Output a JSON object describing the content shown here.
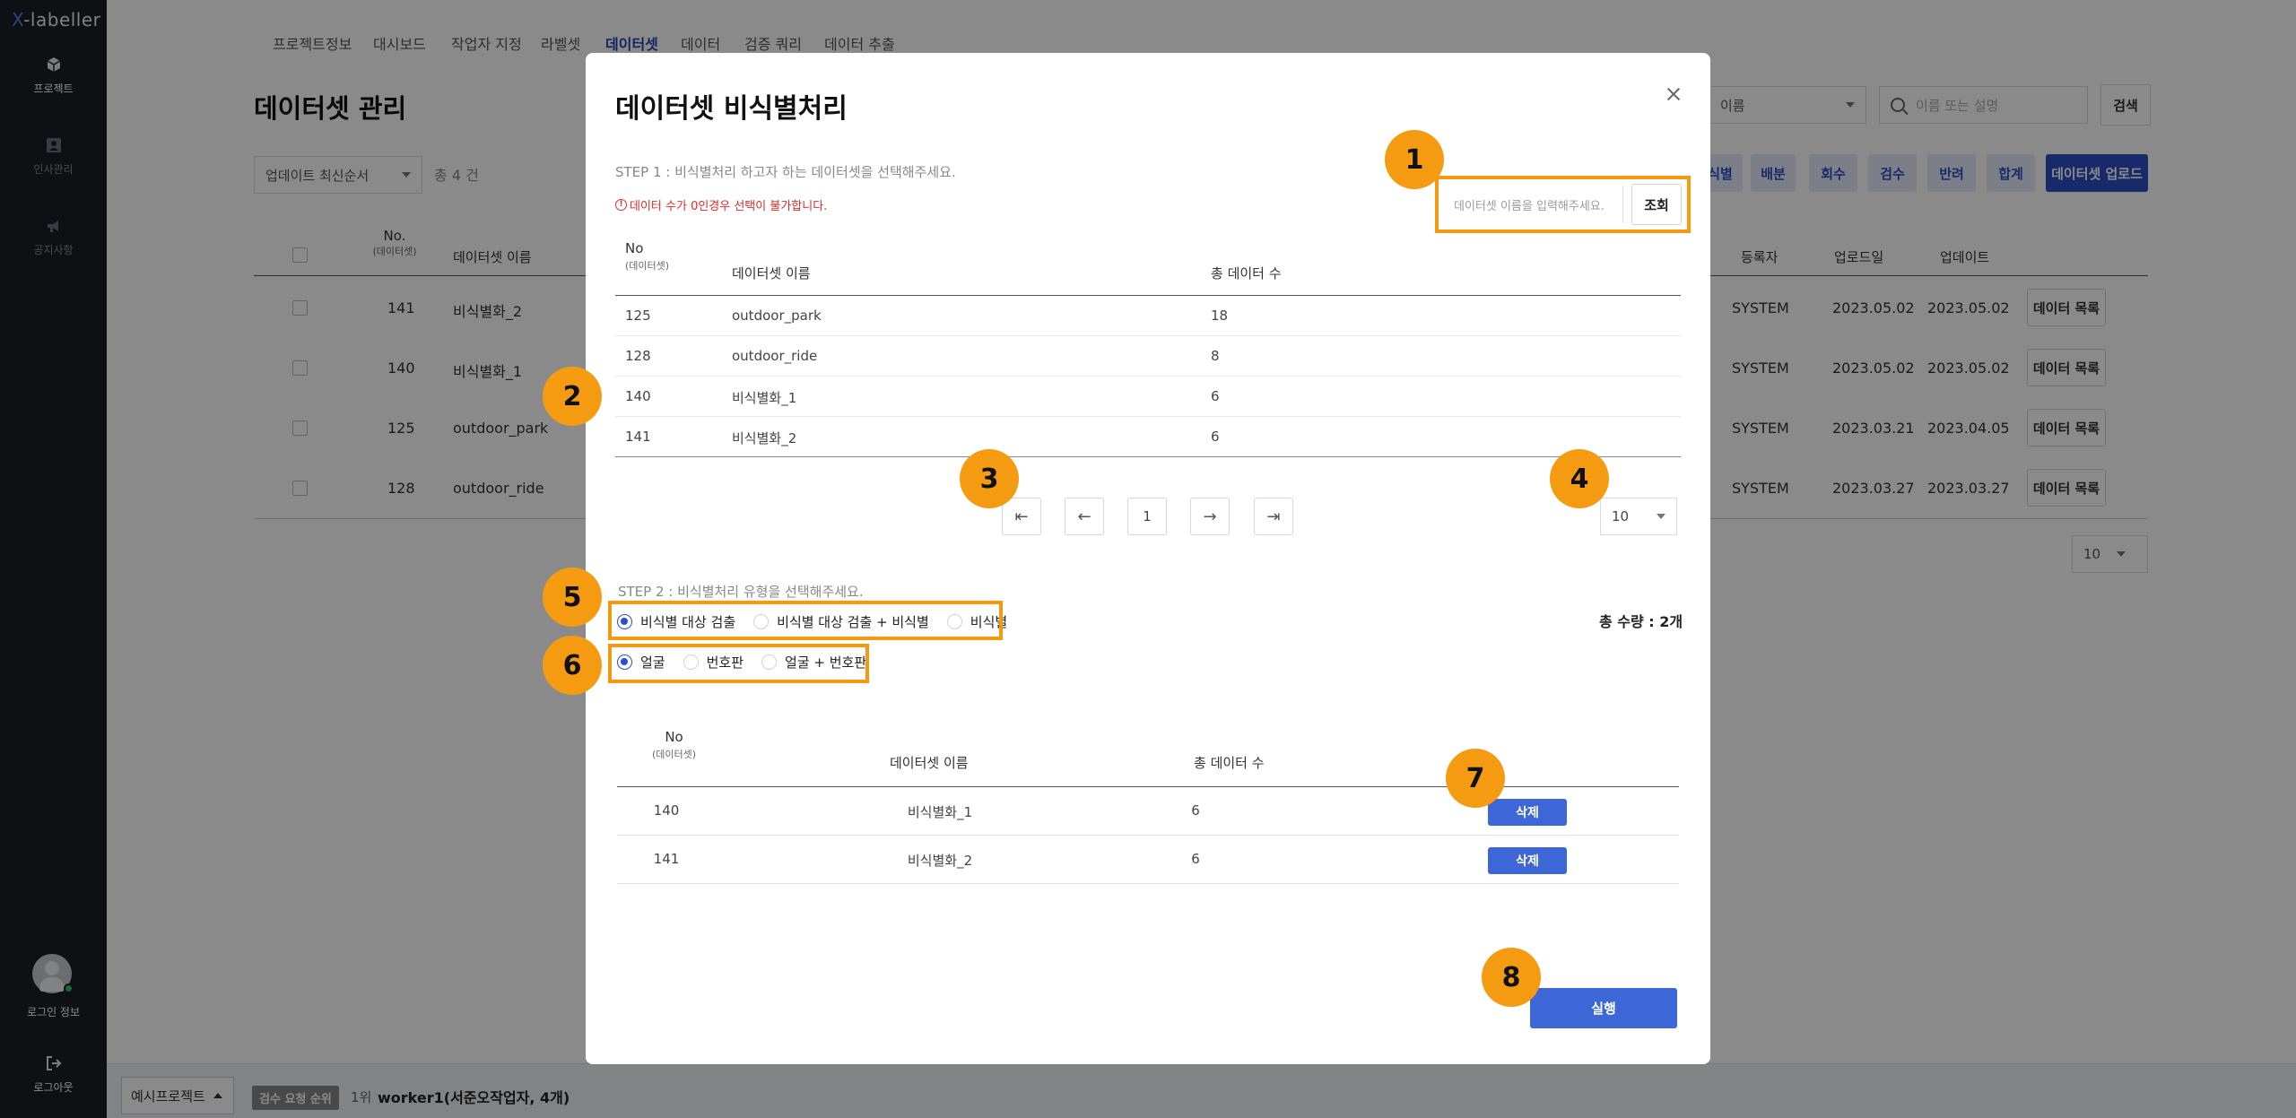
{
  "app": {
    "logo_x": "X",
    "logo_rest": "-labeller"
  },
  "sidebar": {
    "items": [
      {
        "label": "프로젝트",
        "icon": "cube-icon"
      },
      {
        "label": "인사관리",
        "icon": "person-card-icon"
      },
      {
        "label": "공지사항",
        "icon": "megaphone-icon"
      }
    ],
    "login_label": "로그인 정보",
    "logout_label": "로그아웃"
  },
  "background": {
    "tabs": [
      "프로젝트정보",
      "대시보드",
      "작업자 지정",
      "라벨셋",
      "데이터셋",
      "데이터",
      "검증 쿼리",
      "데이터 추출"
    ],
    "active_tab": "데이터셋",
    "title": "데이터셋 관리",
    "sort_select": "업데이트 최신순서",
    "count": "총 4 건",
    "name_select": "이름",
    "search_placeholder": "이름 또는 설명",
    "search_button": "검색",
    "action_buttons": [
      "식별",
      "배분",
      "회수",
      "검수",
      "반려",
      "합계"
    ],
    "upload_button": "데이터셋 업로드",
    "headers": {
      "no": "No.",
      "no_sub": "(데이터셋)",
      "name": "데이터셋 이름",
      "register": "등록자",
      "uploaded": "업로드일",
      "updated": "업데이트"
    },
    "rows": [
      {
        "no": "141",
        "name": "비식별화_2",
        "register": "SYSTEM",
        "uploaded": "2023.05.02",
        "updated": "2023.05.02",
        "btn": "데이터 목록"
      },
      {
        "no": "140",
        "name": "비식별화_1",
        "register": "SYSTEM",
        "uploaded": "2023.05.02",
        "updated": "2023.05.02",
        "btn": "데이터 목록"
      },
      {
        "no": "125",
        "name": "outdoor_park",
        "register": "SYSTEM",
        "uploaded": "2023.03.21",
        "updated": "2023.04.05",
        "btn": "데이터 목록"
      },
      {
        "no": "128",
        "name": "outdoor_ride",
        "register": "SYSTEM",
        "uploaded": "2023.03.27",
        "updated": "2023.03.27",
        "btn": "데이터 목록"
      }
    ],
    "page_size": "10",
    "footer": {
      "project": "예시프로젝트",
      "rank_badge": "검수 요청 순위",
      "rank_num": "1위",
      "rank_text": "worker1(서준오작업자, 4개)"
    }
  },
  "modal": {
    "title": "데이터셋 비식별처리",
    "step1": "STEP 1 : 비식별처리 하고자 하는 데이터셋을 선택해주세요.",
    "warning": "데이터 수가 0인경우 선택이 불가합니다.",
    "search_placeholder": "데이터셋 이름을 입력해주세요.",
    "search_button": "조회",
    "table_headers": {
      "no": "No",
      "no_sub": "(데이터셋)",
      "name": "데이터셋 이름",
      "total": "총 데이터 수"
    },
    "rows": [
      {
        "no": "125",
        "name": "outdoor_park",
        "total": "18"
      },
      {
        "no": "128",
        "name": "outdoor_ride",
        "total": "8"
      },
      {
        "no": "140",
        "name": "비식별화_1",
        "total": "6"
      },
      {
        "no": "141",
        "name": "비식별화_2",
        "total": "6"
      }
    ],
    "pagination": {
      "current": "1"
    },
    "page_size": "10",
    "step2": "STEP 2 : 비식별처리 유형을 선택해주세요.",
    "type_options": [
      "비식별 대상 검출",
      "비식별 대상 검출 + 비식별",
      "비식별"
    ],
    "type_selected": 0,
    "target_options": [
      "얼굴",
      "번호판",
      "얼굴 + 번호판"
    ],
    "target_selected": 0,
    "total_label": "총 수량 : 2개",
    "selected_headers": {
      "no": "No",
      "no_sub": "(데이터셋)",
      "name": "데이터셋 이름",
      "total": "총 데이터 수"
    },
    "selected_rows": [
      {
        "no": "140",
        "name": "비식별화_1",
        "total": "6",
        "btn": "삭제"
      },
      {
        "no": "141",
        "name": "비식별화_2",
        "total": "6",
        "btn": "삭제"
      }
    ],
    "run_button": "실행"
  },
  "annotations": {
    "markers": [
      "1",
      "2",
      "3",
      "4",
      "5",
      "6",
      "7",
      "8"
    ],
    "color": "#f59b12"
  }
}
